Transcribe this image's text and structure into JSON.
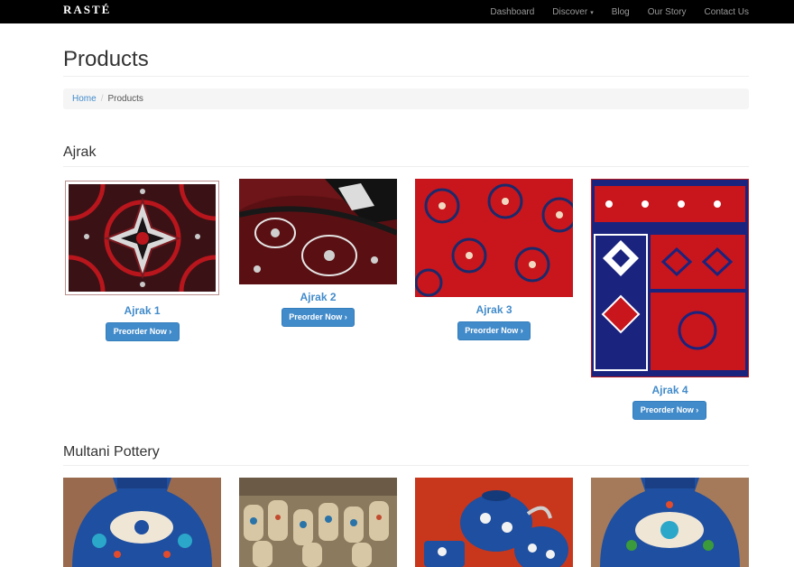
{
  "brand": "RASTÉ",
  "nav": {
    "items": [
      "Dashboard",
      "Discover",
      "Blog",
      "Our Story",
      "Contact Us"
    ],
    "dropdown_caret": "▾"
  },
  "page": {
    "title": "Products",
    "breadcrumb": {
      "home": "Home",
      "separator": "/",
      "current": "Products"
    }
  },
  "sections": [
    {
      "title": "Ajrak",
      "products": [
        {
          "name": "Ajrak 1",
          "button": "Preorder Now ›"
        },
        {
          "name": "Ajrak 2",
          "button": "Preorder Now ›"
        },
        {
          "name": "Ajrak 3",
          "button": "Preorder Now ›"
        },
        {
          "name": "Ajrak 4",
          "button": "Preorder Now ›"
        }
      ]
    },
    {
      "title": "Multani Pottery",
      "products": []
    }
  ],
  "colors": {
    "navbar": "#000000",
    "link": "#428bca",
    "button": "#428bca",
    "ajrak_red": "#b8161c",
    "ajrak_dark": "#1a1010",
    "pottery_blue": "#1e4fa0"
  }
}
